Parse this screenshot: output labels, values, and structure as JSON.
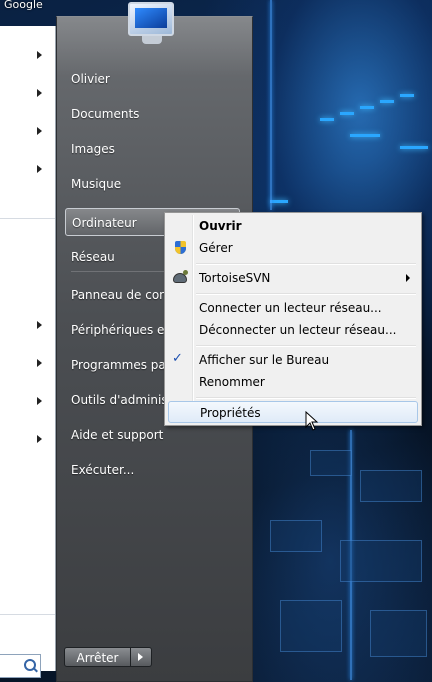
{
  "desktop": {
    "google_icon_label": "Google"
  },
  "start_menu": {
    "right_items": [
      {
        "label": "Olivier"
      },
      {
        "label": "Documents"
      },
      {
        "label": "Images"
      },
      {
        "label": "Musique"
      },
      {
        "label": "Ordinateur"
      },
      {
        "label": "Réseau"
      },
      {
        "label": "Panneau de configuration"
      },
      {
        "label": "Périphériques et imprimantes"
      },
      {
        "label": "Programmes par défaut"
      },
      {
        "label": "Outils d'administration"
      },
      {
        "label": "Aide et support"
      },
      {
        "label": "Exécuter..."
      }
    ],
    "shutdown_label": "Arrêter"
  },
  "context_menu": {
    "items": [
      {
        "label": "Ouvrir",
        "bold": true
      },
      {
        "label": "Gérer",
        "icon": "uac-shield-icon"
      },
      {
        "label": "TortoiseSVN",
        "icon": "tortoisesvn-icon",
        "submenu": true
      },
      {
        "label": "Connecter un lecteur réseau..."
      },
      {
        "label": "Déconnecter un lecteur réseau..."
      },
      {
        "label": "Afficher sur le Bureau",
        "checked": true
      },
      {
        "label": "Renommer"
      },
      {
        "label": "Propriétés",
        "hovered": true
      }
    ],
    "check_glyph": "✓"
  }
}
